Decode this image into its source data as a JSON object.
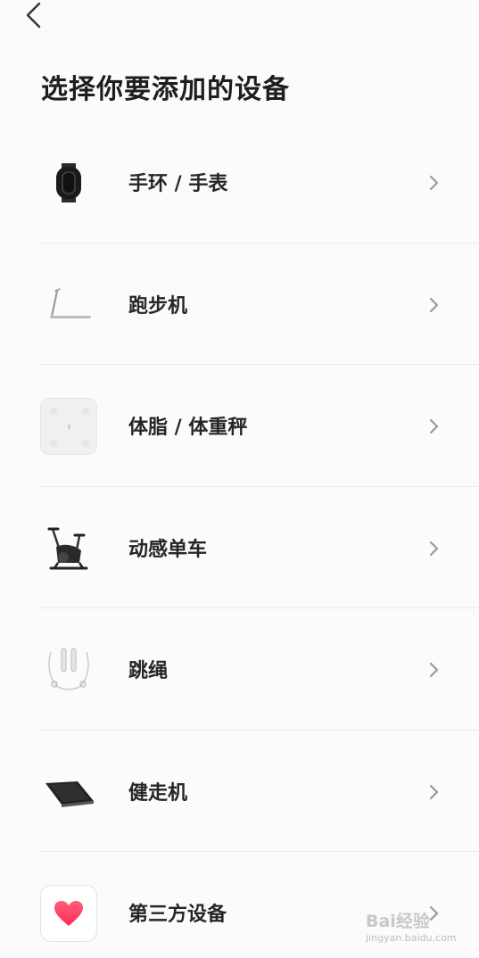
{
  "header": {
    "back_icon": "chevron-left-icon"
  },
  "page_title": "选择你要添加的设备",
  "devices": [
    {
      "label": "手环 / 手表",
      "icon": "band-icon"
    },
    {
      "label": "跑步机",
      "icon": "treadmill-icon"
    },
    {
      "label": "体脂 / 体重秤",
      "icon": "scale-icon"
    },
    {
      "label": "动感单车",
      "icon": "spin-bike-icon"
    },
    {
      "label": "跳绳",
      "icon": "jump-rope-icon"
    },
    {
      "label": "健走机",
      "icon": "walking-pad-icon"
    },
    {
      "label": "第三方设备",
      "icon": "heart-icon"
    }
  ],
  "watermark": {
    "brand": "Bai",
    "site": "jingyan.baidu.com",
    "suffix": "经验"
  },
  "colors": {
    "background": "#fbfbfb",
    "title": "#1e1e1e",
    "chevron": "#9a9a9a",
    "heart": "#ff2d55"
  }
}
